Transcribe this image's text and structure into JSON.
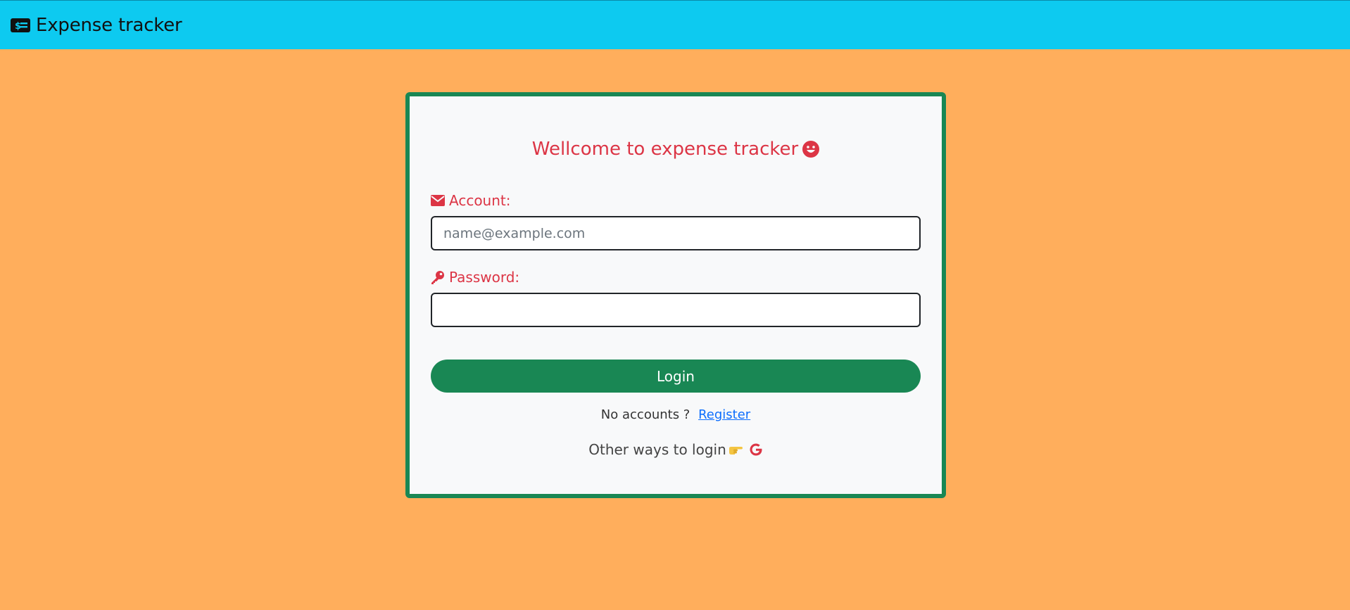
{
  "navbar": {
    "icon": "money-bill-icon",
    "title": "Expense tracker"
  },
  "card": {
    "title": "Wellcome to expense tracker",
    "title_icon": "smile-icon",
    "account": {
      "icon": "envelope-icon",
      "label": "Account:",
      "placeholder": "name@example.com",
      "value": ""
    },
    "password": {
      "icon": "key-icon",
      "label": "Password:",
      "value": ""
    },
    "login_label": "Login",
    "register_prompt": "No accounts ?",
    "register_link": "Register",
    "other_ways": "Other ways to login",
    "other_icons": [
      "pointing-hand-icon",
      "google-icon"
    ]
  },
  "colors": {
    "background": "#ffae5c",
    "navbar": "#0dcaf0",
    "card_border": "#198754",
    "accent_red": "#dc3545",
    "button": "#198754",
    "link": "#0d6efd"
  }
}
